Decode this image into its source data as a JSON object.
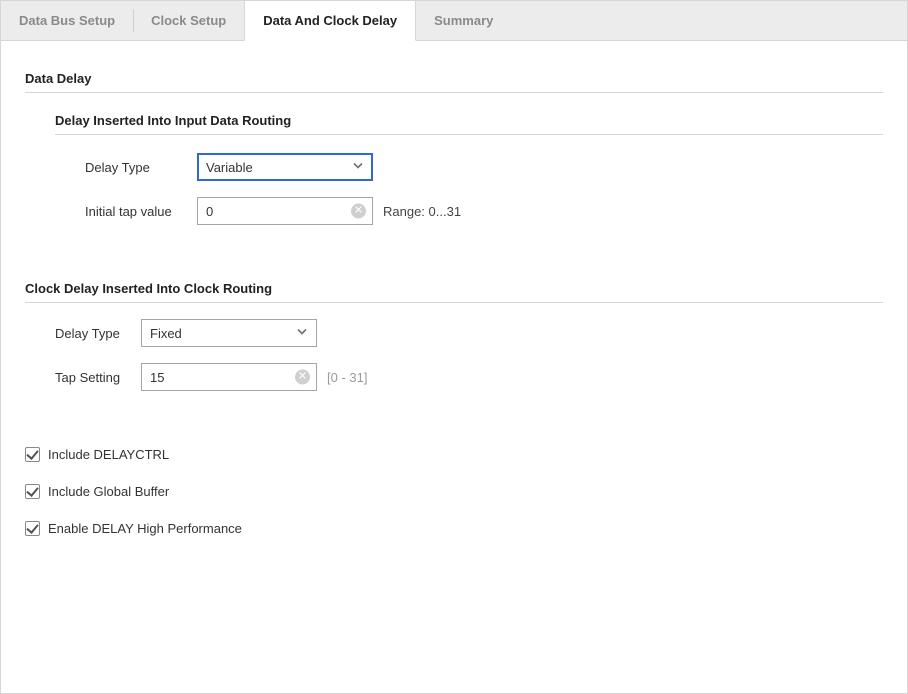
{
  "tabs": [
    {
      "label": "Data Bus Setup",
      "active": false
    },
    {
      "label": "Clock Setup",
      "active": false
    },
    {
      "label": "Data And Clock Delay",
      "active": true
    },
    {
      "label": "Summary",
      "active": false
    }
  ],
  "data_delay": {
    "title": "Data Delay",
    "input_routing": {
      "title": "Delay Inserted Into Input Data Routing",
      "delay_type_label": "Delay Type",
      "delay_type_value": "Variable",
      "initial_tap_label": "Initial tap value",
      "initial_tap_value": "0",
      "range_hint": "Range: 0...31"
    }
  },
  "clock_delay": {
    "title": "Clock Delay Inserted Into Clock Routing",
    "delay_type_label": "Delay Type",
    "delay_type_value": "Fixed",
    "tap_setting_label": "Tap Setting",
    "tap_setting_value": "15",
    "range_hint": "[0 - 31]"
  },
  "options": {
    "include_delayctrl": {
      "label": "Include DELAYCTRL",
      "checked": true
    },
    "include_global_buffer": {
      "label": "Include Global Buffer",
      "checked": true
    },
    "enable_high_perf": {
      "label": "Enable DELAY High Performance",
      "checked": true
    }
  }
}
